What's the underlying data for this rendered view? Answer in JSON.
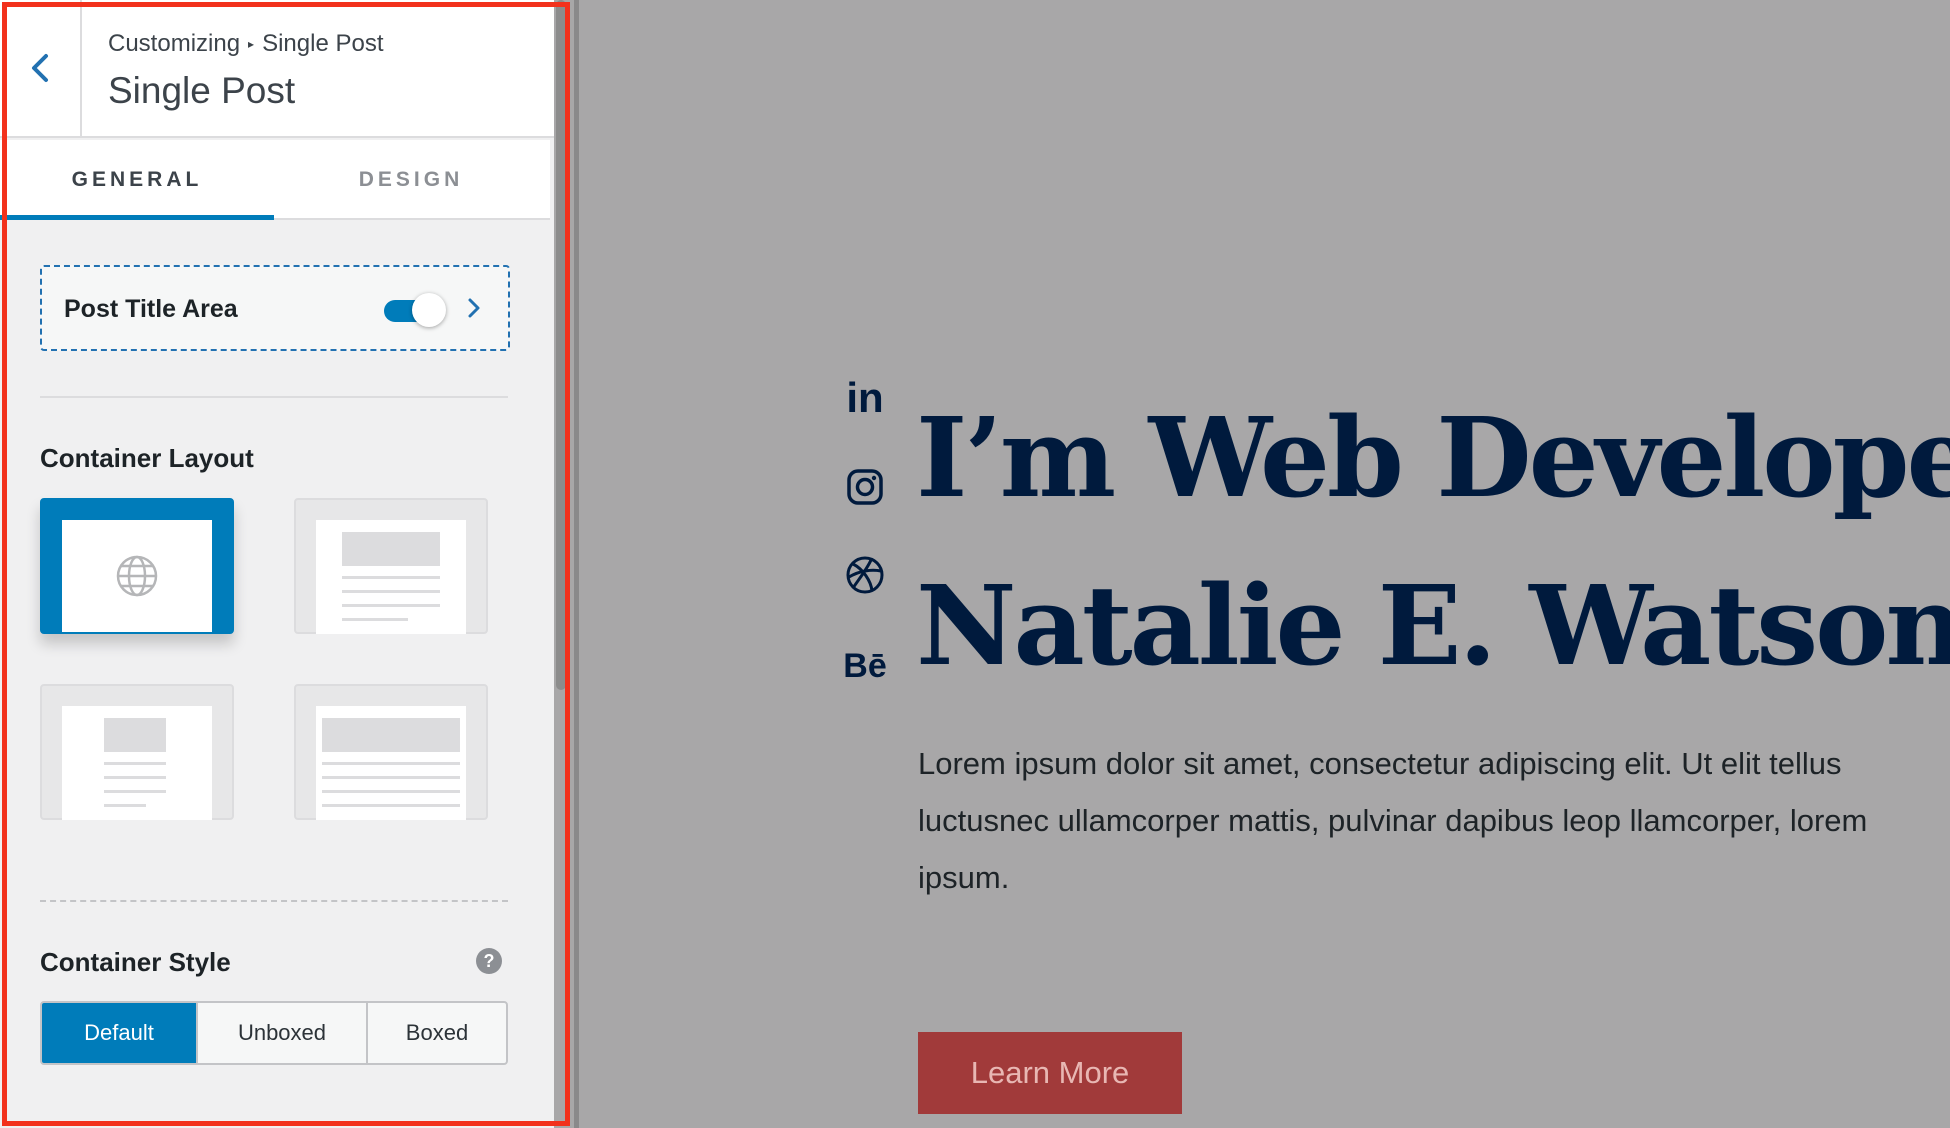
{
  "customizer": {
    "breadcrumb": {
      "root": "Customizing",
      "separator": "▸",
      "current": "Single Post"
    },
    "title": "Single Post",
    "tabs": [
      {
        "label": "GENERAL",
        "active": true
      },
      {
        "label": "DESIGN",
        "active": false
      }
    ],
    "post_title_area": {
      "label": "Post Title Area",
      "enabled": true
    },
    "container_layout": {
      "label": "Container Layout",
      "selected_index": 0
    },
    "container_style": {
      "label": "Container Style",
      "help": "?",
      "options": [
        "Default",
        "Unboxed",
        "Boxed"
      ],
      "selected": "Default"
    }
  },
  "preview": {
    "social": {
      "linkedin": "in",
      "behance": "Bē"
    },
    "heading_line1": "I’m Web Developer",
    "heading_line2": "Natalie E. Watson",
    "paragraph": "Lorem ipsum dolor sit amet, consectetur adipiscing elit. Ut elit tellus luctusnec ullamcorper mattis, pulvinar dapibus leop llamcorper, lorem ipsum.",
    "button_label": "Learn More"
  },
  "colors": {
    "accent": "#007cba",
    "highlight": "#f2311c",
    "heading": "#001a3d",
    "button": "#a13a3a",
    "preview_bg": "#a8a7a8"
  }
}
